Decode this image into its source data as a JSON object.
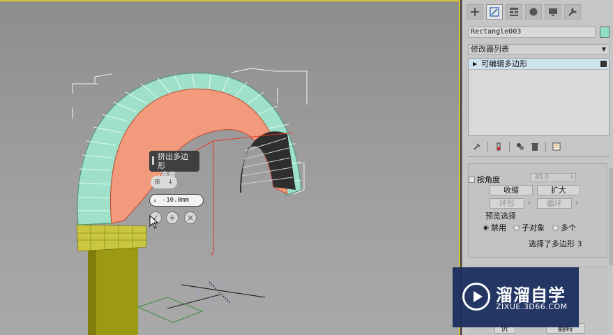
{
  "viewport": {
    "caddy_title": "挤出多边形",
    "caddy_subtitle": "-高度",
    "caddy_value": "-10.0mm"
  },
  "command_panel": {
    "tabs": [
      "create-icon",
      "modify-icon",
      "hierarchy-icon",
      "motion-icon",
      "display-icon",
      "utilities-icon"
    ],
    "active_tab": "modify-icon",
    "object_name": "Rectangle003",
    "object_color": "#8fe0c0",
    "modifier_list": "修改器列表",
    "stack_items": [
      {
        "label": "可编辑多边形"
      }
    ],
    "stack_tools": [
      "pin-stack-icon",
      "show-end-result-icon",
      "make-unique-icon",
      "remove-modifier-icon",
      "configure-sets-icon"
    ],
    "selection": {
      "by_angle_label": "按角度",
      "by_angle_value": "45.0",
      "shrink": "收缩",
      "grow": "扩大",
      "ring": "环形",
      "loop": "循环",
      "preview_group": "预览选择",
      "preview_options": [
        "禁用",
        "子对象",
        "多个"
      ],
      "preview_selected": "禁用",
      "status": "选择了多边形 3"
    },
    "lower_buttons": {
      "left": "忻",
      "right": "翻转"
    }
  },
  "watermark": {
    "title": "溜溜自学",
    "url": "ZIXUE.3D66.COM"
  },
  "colors": {
    "viewport_border": "#d8c23a",
    "selected_faces": "#f39a7c",
    "mesh": "#8fd6bd",
    "pillar": "#9c9a12"
  }
}
